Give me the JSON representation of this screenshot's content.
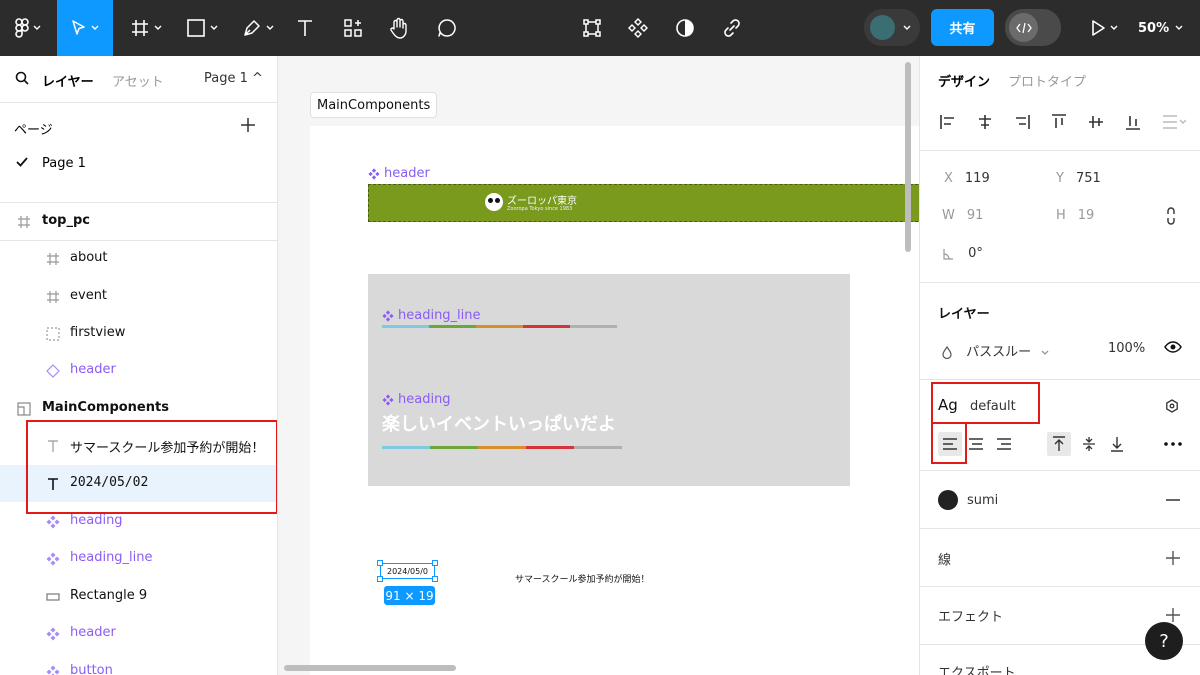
{
  "toolbar": {
    "share_label": "共有",
    "zoom_label": "50%",
    "icons": [
      "figma-menu-icon",
      "move-tool-icon",
      "frame-tool-icon",
      "shape-tool-icon",
      "pen-tool-icon",
      "text-tool-icon",
      "resources-icon",
      "hand-tool-icon",
      "comment-tool-icon",
      "component-icon",
      "instance-icon",
      "contrast-icon",
      "link-icon",
      "dev-mode-icon",
      "play-icon"
    ],
    "accent_color": "#0d99ff"
  },
  "left_panel": {
    "tabs": {
      "layers": "レイヤー",
      "assets": "アセット",
      "page_selector": "Page 1 ^"
    },
    "pages_title": "ページ",
    "current_page": "Page 1",
    "layers": [
      {
        "label": "top_pc",
        "kind": "frame"
      },
      {
        "label": "about",
        "kind": "frame"
      },
      {
        "label": "event",
        "kind": "frame"
      },
      {
        "label": "firstview",
        "kind": "section"
      },
      {
        "label": "header",
        "kind": "instance"
      },
      {
        "label": "MainComponents",
        "kind": "section"
      },
      {
        "label": "サマースクール参加予約が開始！",
        "kind": "text"
      },
      {
        "label": "2024/05/02",
        "kind": "text"
      },
      {
        "label": "heading",
        "kind": "component"
      },
      {
        "label": "heading_line",
        "kind": "component"
      },
      {
        "label": "Rectangle 9",
        "kind": "rectangle"
      },
      {
        "label": "header",
        "kind": "component"
      },
      {
        "label": "button",
        "kind": "component"
      }
    ]
  },
  "canvas": {
    "frame_label": "MainComponents",
    "header_component_label": "header",
    "brand_name": "ズーロッパ東京",
    "brand_sub": "Zooropa Tokyo since 1983",
    "heading_line_label": "heading_line",
    "heading_label": "heading",
    "heading_text": "楽しいイベントいっぱいだよ",
    "selected_text": "2024/05/0",
    "dimension_badge": "91 × 19",
    "summer_text": "サマースクール参加予約が開始！",
    "header_color": "#7a9a1e",
    "line_colors": [
      "#7ecbe0",
      "#6aa83c",
      "#d98d2c",
      "#d2343a",
      "#b0b0b0"
    ]
  },
  "right_panel": {
    "tabs": {
      "design": "デザイン",
      "prototype": "プロトタイプ"
    },
    "x_label": "X",
    "x_value": "119",
    "y_label": "Y",
    "y_value": "751",
    "w_label": "W",
    "w_value": "91",
    "h_label": "H",
    "h_value": "19",
    "rotation_value": "0°",
    "layer_title": "レイヤー",
    "blend_mode": "パススルー",
    "opacity": "100%",
    "text_style_glyph": "Ag",
    "text_style_name": "default",
    "fill_name": "sumi",
    "fill_color": "#222222",
    "stroke_title": "線",
    "effects_title": "エフェクト",
    "export_title": "エクスポート",
    "help_label": "?"
  }
}
